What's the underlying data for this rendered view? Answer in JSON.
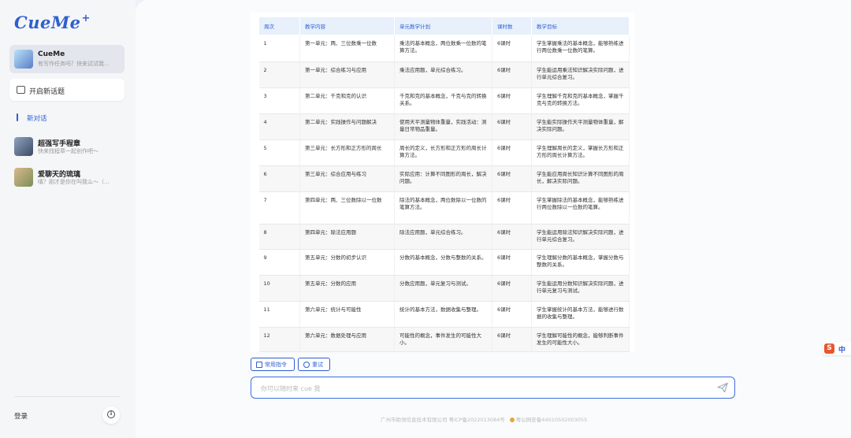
{
  "app": {
    "logo": "CueMe",
    "logo_mark": "+"
  },
  "sidebar": {
    "active_chat": {
      "name": "CueMe",
      "preview": "有写作任务吗？快来试试我..."
    },
    "new_topic_label": "开启新话题",
    "new_chat_label": "新对话",
    "chats": [
      {
        "name": "超强写手程章",
        "preview": "快来找程章一起创作吧～"
      },
      {
        "name": "爱聊天的琉璃",
        "preview": "嗔？刚才是你在叫我么～（..."
      }
    ],
    "login_label": "登录"
  },
  "table": {
    "headers": [
      "周次",
      "教学内容",
      "单元教学计划",
      "课时数",
      "教学目标"
    ],
    "rows": [
      [
        "1",
        "第一单元：两、三位数乘一位数",
        "乘法的基本概念，两位数乘一位数的笔算方法。",
        "6课时",
        "学生掌握乘法的基本概念，能够熟练进行两位数乘一位数的笔算。"
      ],
      [
        "2",
        "第一单元：综合练习与应用",
        "乘法应用题，单元综合练习。",
        "6课时",
        "学生能运用乘法知识解决实际问题，进行单元综合复习。"
      ],
      [
        "3",
        "第二单元：千克和克的认识",
        "千克和克的基本概念，千克与克的转换关系。",
        "6课时",
        "学生理解千克和克的基本概念，掌握千克与克的转换方法。"
      ],
      [
        "4",
        "第二单元：实践操作与问题解决",
        "使用天平测量物体重量，实践活动：测量日常物品重量。",
        "6课时",
        "学生能实际操作天平测量物体重量，解决实际问题。"
      ],
      [
        "5",
        "第三单元：长方形和正方形的周长",
        "周长的定义，长方形和正方形的周长计算方法。",
        "6课时",
        "学生理解周长的定义，掌握长方形和正方形的周长计算方法。"
      ],
      [
        "6",
        "第三单元：综合应用与练习",
        "实际应用：计算不同图形的周长，解决问题。",
        "6课时",
        "学生能应用周长知识计算不同图形的周长，解决实际问题。"
      ],
      [
        "7",
        "第四单元：两、三位数除以一位数",
        "除法的基本概念，两位数除以一位数的笔算方法。",
        "6课时",
        "学生掌握除法的基本概念，能够熟练进行两位数除以一位数的笔算。"
      ],
      [
        "8",
        "第四单元：除法应用题",
        "除法应用题，单元综合练习。",
        "6课时",
        "学生能运用除法知识解决实际问题，进行单元综合复习。"
      ],
      [
        "9",
        "第五单元：分数的初步认识",
        "分数的基本概念，分数与整数的关系。",
        "6课时",
        "学生理解分数的基本概念，掌握分数与整数的关系。"
      ],
      [
        "10",
        "第五单元：分数的应用",
        "分数应用题，单元复习与测试。",
        "6课时",
        "学生能运用分数知识解决实际问题，进行单元复习与测试。"
      ],
      [
        "11",
        "第六单元：统计与可能性",
        "统计的基本方法，数据收集与整理。",
        "6课时",
        "学生掌握统计的基本方法，能够进行数据的收集与整理。"
      ],
      [
        "12",
        "第六单元：数据处理与应用",
        "可能性的概念，事件发生的可能性大小。",
        "6课时",
        "学生理解可能性的概念，能够判断事件发生的可能性大小。"
      ]
    ]
  },
  "actions": {
    "common_commands": "常用指令",
    "retry": "重试"
  },
  "input": {
    "placeholder": "你可以随时来 cue 我"
  },
  "footer": {
    "company": "广州市助领信息技术有限公司 粤ICP备2022013084号",
    "police": "粤公网安备44010502003055"
  },
  "ime": {
    "logo": "S",
    "mode": "中"
  },
  "colors": {
    "accent": "#2f5fd0",
    "sidebar_bg": "#f5f6f8",
    "header_bg": "#e7f0fb"
  }
}
